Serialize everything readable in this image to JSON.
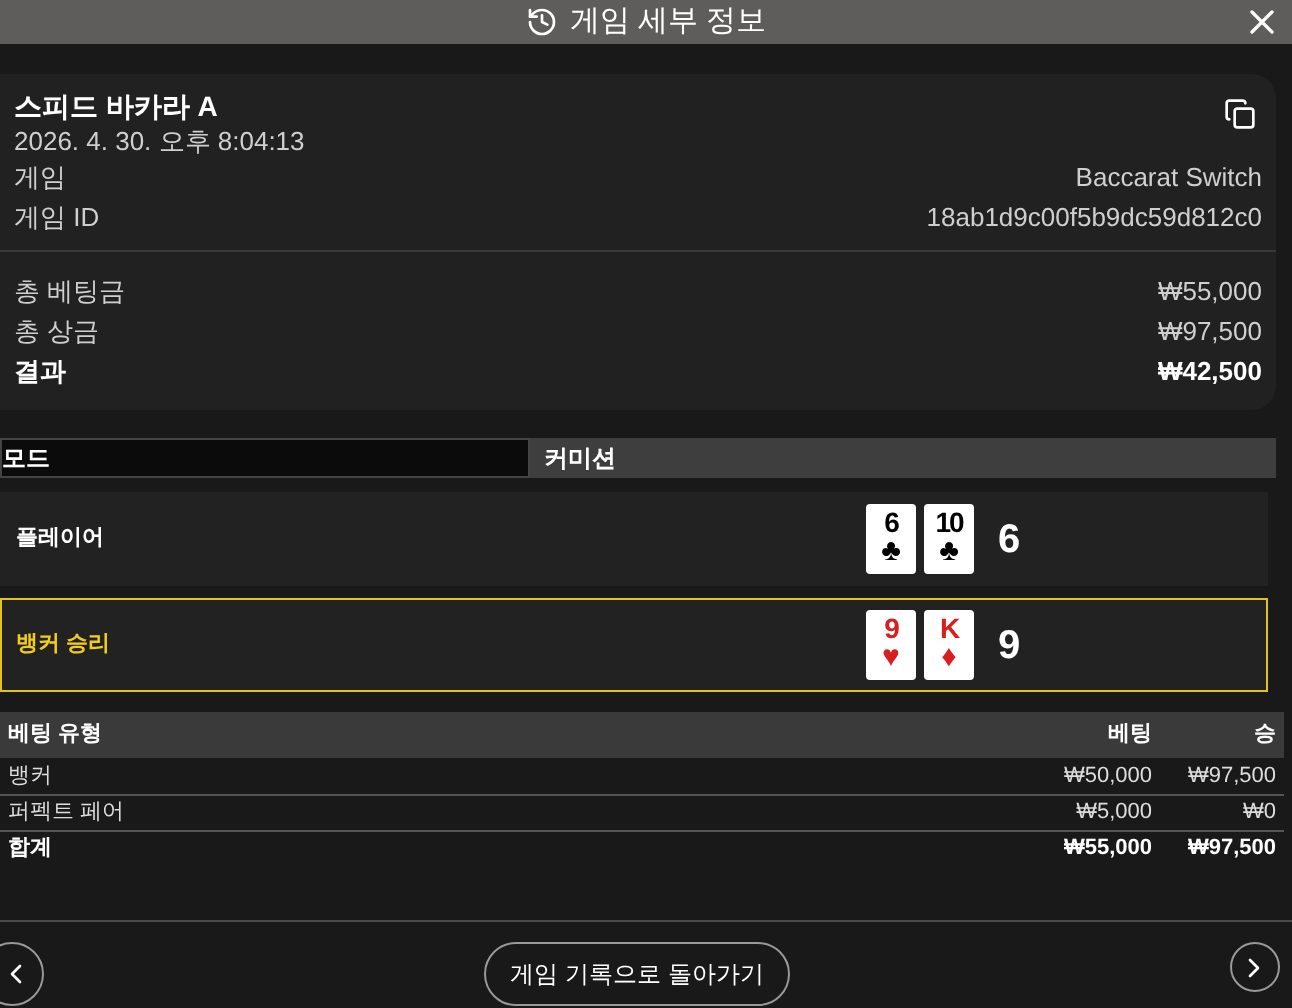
{
  "header": {
    "title": "게임 세부 정보"
  },
  "summary": {
    "table_name": "스피드 바카라 A",
    "datetime": "2026. 4. 30. 오후 8:04:13",
    "details": [
      {
        "label": "게임",
        "value": "Baccarat Switch"
      },
      {
        "label": "게임 ID",
        "value": "18ab1d9c00f5b9dc59d812c0"
      }
    ],
    "totals": [
      {
        "label": "총 베팅금",
        "value": "₩55,000",
        "bold": false
      },
      {
        "label": "총 상금",
        "value": "₩97,500",
        "bold": false
      },
      {
        "label": "결과",
        "value": "₩42,500",
        "bold": true
      }
    ]
  },
  "mode": {
    "label": "모드",
    "value": "커미션"
  },
  "hands": [
    {
      "name": "플레이어",
      "winner": false,
      "score": "6",
      "cards": [
        {
          "rank": "6",
          "suit": "♣",
          "red": false
        },
        {
          "rank": "10",
          "suit": "♣",
          "red": false
        }
      ]
    },
    {
      "name": "뱅커 승리",
      "winner": true,
      "score": "9",
      "cards": [
        {
          "rank": "9",
          "suit": "♥",
          "red": true
        },
        {
          "rank": "K",
          "suit": "♦",
          "red": true
        }
      ]
    }
  ],
  "bets": {
    "columns": [
      "베팅 유형",
      "베팅",
      "승"
    ],
    "rows": [
      {
        "cells": [
          "뱅커",
          "₩50,000",
          "₩97,500"
        ],
        "total": false
      },
      {
        "cells": [
          "퍼펙트 페어",
          "₩5,000",
          "₩0"
        ],
        "total": false
      },
      {
        "cells": [
          "합계",
          "₩55,000",
          "₩97,500"
        ],
        "total": true
      }
    ]
  },
  "footer": {
    "back_button": "게임 기록으로 돌아가기"
  }
}
